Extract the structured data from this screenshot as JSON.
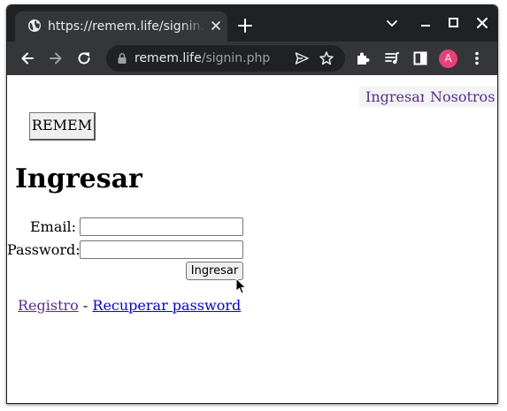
{
  "browser": {
    "tab": {
      "title": "https://remem.life/signin.php",
      "favicon": "globe-icon"
    },
    "address_bar": {
      "host": "remem.life",
      "path": "/signin.php"
    },
    "profile_initial": "A",
    "colors": {
      "frame": "#202124",
      "toolbar": "#35363a",
      "avatar": "#e94076"
    }
  },
  "page": {
    "nav": {
      "login": "Ingresar",
      "about": "Nosotros"
    },
    "logo_button": "REMEM",
    "heading": "Ingresar",
    "form": {
      "email_label": "Email:",
      "email_value": "",
      "password_label": "Password:",
      "password_value": "",
      "submit_label": "Ingresar"
    },
    "footer": {
      "register": "Registro",
      "separator": "-",
      "recover": "Recuperar password"
    },
    "colors": {
      "visited_link": "#5a2c91",
      "link": "#0000ee"
    }
  }
}
